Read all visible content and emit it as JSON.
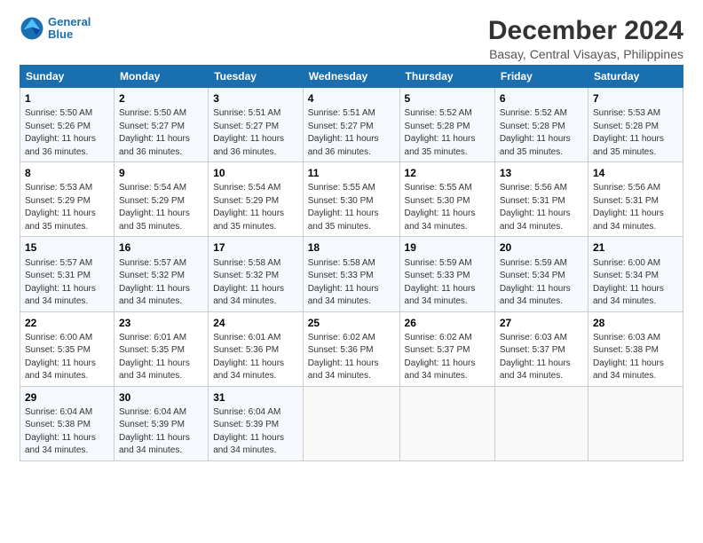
{
  "app": {
    "logo_line1": "General",
    "logo_line2": "Blue"
  },
  "header": {
    "title": "December 2024",
    "subtitle": "Basay, Central Visayas, Philippines"
  },
  "columns": [
    "Sunday",
    "Monday",
    "Tuesday",
    "Wednesday",
    "Thursday",
    "Friday",
    "Saturday"
  ],
  "weeks": [
    [
      {
        "day": "1",
        "sunrise": "5:50 AM",
        "sunset": "5:26 PM",
        "daylight": "11 hours and 36 minutes."
      },
      {
        "day": "2",
        "sunrise": "5:50 AM",
        "sunset": "5:27 PM",
        "daylight": "11 hours and 36 minutes."
      },
      {
        "day": "3",
        "sunrise": "5:51 AM",
        "sunset": "5:27 PM",
        "daylight": "11 hours and 36 minutes."
      },
      {
        "day": "4",
        "sunrise": "5:51 AM",
        "sunset": "5:27 PM",
        "daylight": "11 hours and 36 minutes."
      },
      {
        "day": "5",
        "sunrise": "5:52 AM",
        "sunset": "5:28 PM",
        "daylight": "11 hours and 35 minutes."
      },
      {
        "day": "6",
        "sunrise": "5:52 AM",
        "sunset": "5:28 PM",
        "daylight": "11 hours and 35 minutes."
      },
      {
        "day": "7",
        "sunrise": "5:53 AM",
        "sunset": "5:28 PM",
        "daylight": "11 hours and 35 minutes."
      }
    ],
    [
      {
        "day": "8",
        "sunrise": "5:53 AM",
        "sunset": "5:29 PM",
        "daylight": "11 hours and 35 minutes."
      },
      {
        "day": "9",
        "sunrise": "5:54 AM",
        "sunset": "5:29 PM",
        "daylight": "11 hours and 35 minutes."
      },
      {
        "day": "10",
        "sunrise": "5:54 AM",
        "sunset": "5:29 PM",
        "daylight": "11 hours and 35 minutes."
      },
      {
        "day": "11",
        "sunrise": "5:55 AM",
        "sunset": "5:30 PM",
        "daylight": "11 hours and 35 minutes."
      },
      {
        "day": "12",
        "sunrise": "5:55 AM",
        "sunset": "5:30 PM",
        "daylight": "11 hours and 34 minutes."
      },
      {
        "day": "13",
        "sunrise": "5:56 AM",
        "sunset": "5:31 PM",
        "daylight": "11 hours and 34 minutes."
      },
      {
        "day": "14",
        "sunrise": "5:56 AM",
        "sunset": "5:31 PM",
        "daylight": "11 hours and 34 minutes."
      }
    ],
    [
      {
        "day": "15",
        "sunrise": "5:57 AM",
        "sunset": "5:31 PM",
        "daylight": "11 hours and 34 minutes."
      },
      {
        "day": "16",
        "sunrise": "5:57 AM",
        "sunset": "5:32 PM",
        "daylight": "11 hours and 34 minutes."
      },
      {
        "day": "17",
        "sunrise": "5:58 AM",
        "sunset": "5:32 PM",
        "daylight": "11 hours and 34 minutes."
      },
      {
        "day": "18",
        "sunrise": "5:58 AM",
        "sunset": "5:33 PM",
        "daylight": "11 hours and 34 minutes."
      },
      {
        "day": "19",
        "sunrise": "5:59 AM",
        "sunset": "5:33 PM",
        "daylight": "11 hours and 34 minutes."
      },
      {
        "day": "20",
        "sunrise": "5:59 AM",
        "sunset": "5:34 PM",
        "daylight": "11 hours and 34 minutes."
      },
      {
        "day": "21",
        "sunrise": "6:00 AM",
        "sunset": "5:34 PM",
        "daylight": "11 hours and 34 minutes."
      }
    ],
    [
      {
        "day": "22",
        "sunrise": "6:00 AM",
        "sunset": "5:35 PM",
        "daylight": "11 hours and 34 minutes."
      },
      {
        "day": "23",
        "sunrise": "6:01 AM",
        "sunset": "5:35 PM",
        "daylight": "11 hours and 34 minutes."
      },
      {
        "day": "24",
        "sunrise": "6:01 AM",
        "sunset": "5:36 PM",
        "daylight": "11 hours and 34 minutes."
      },
      {
        "day": "25",
        "sunrise": "6:02 AM",
        "sunset": "5:36 PM",
        "daylight": "11 hours and 34 minutes."
      },
      {
        "day": "26",
        "sunrise": "6:02 AM",
        "sunset": "5:37 PM",
        "daylight": "11 hours and 34 minutes."
      },
      {
        "day": "27",
        "sunrise": "6:03 AM",
        "sunset": "5:37 PM",
        "daylight": "11 hours and 34 minutes."
      },
      {
        "day": "28",
        "sunrise": "6:03 AM",
        "sunset": "5:38 PM",
        "daylight": "11 hours and 34 minutes."
      }
    ],
    [
      {
        "day": "29",
        "sunrise": "6:04 AM",
        "sunset": "5:38 PM",
        "daylight": "11 hours and 34 minutes."
      },
      {
        "day": "30",
        "sunrise": "6:04 AM",
        "sunset": "5:39 PM",
        "daylight": "11 hours and 34 minutes."
      },
      {
        "day": "31",
        "sunrise": "6:04 AM",
        "sunset": "5:39 PM",
        "daylight": "11 hours and 34 minutes."
      },
      null,
      null,
      null,
      null
    ]
  ]
}
